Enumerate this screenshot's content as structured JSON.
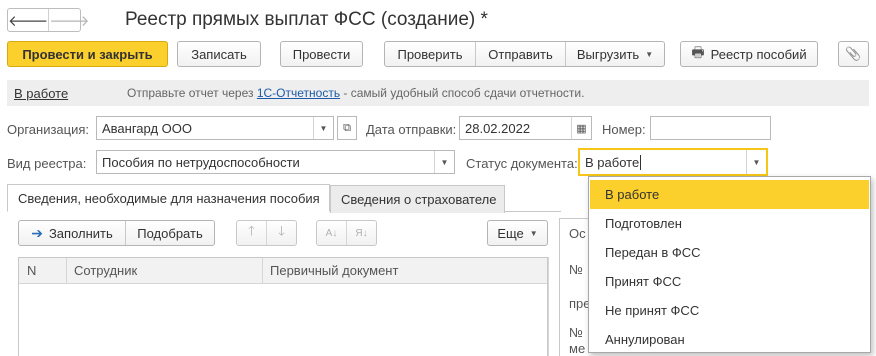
{
  "window": {
    "title": "Реестр прямых выплат ФСС (создание) *",
    "back_glyph": "🡐",
    "forward_glyph": "🡒"
  },
  "toolbar": {
    "post_close": "Провести и закрыть",
    "save": "Записать",
    "post": "Провести",
    "check": "Проверить",
    "send": "Отправить",
    "upload": "Выгрузить",
    "registry": "Реестр пособий",
    "attach_glyph": "📎",
    "printer_glyph": "🖶"
  },
  "info": {
    "status": "В работе",
    "text_before": "Отправьте отчет через ",
    "link": "1С-Отчетность",
    "text_after": " - самый удобный способ сдачи отчетности."
  },
  "form": {
    "org_label": "Организация:",
    "org_value": "Авангард ООО",
    "date_label": "Дата отправки:",
    "date_value": "28.02.2022",
    "number_label": "Номер:",
    "number_value": "",
    "type_label": "Вид реестра:",
    "type_value": "Пособия по нетрудоспособности",
    "status_label": "Статус документа:",
    "status_value": "В работе"
  },
  "tabs": [
    {
      "label": "Сведения, необходимые для назначения пособия"
    },
    {
      "label": "Сведения о страхователе"
    }
  ],
  "table_toolbar": {
    "fill": "Заполнить",
    "pick": "Подобрать",
    "more": "Еще"
  },
  "table": {
    "columns": [
      "N",
      "Сотрудник",
      "Первичный документ"
    ]
  },
  "right_panel": {
    "line1": "Ос",
    "line2": "№",
    "line3": "пре",
    "line4": "№",
    "line5": "ме"
  },
  "dropdown": {
    "items": [
      "В работе",
      "Подготовлен",
      "Передан в ФСС",
      "Принят ФСС",
      "Не принят ФСС",
      "Аннулирован"
    ],
    "selected_index": 0
  },
  "colors": {
    "accent": "#fbcf2c",
    "link": "#1a5aa8"
  }
}
